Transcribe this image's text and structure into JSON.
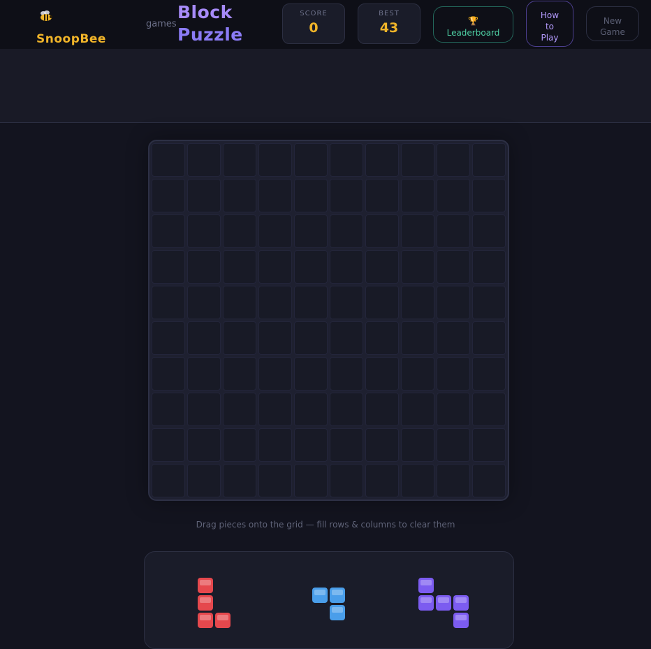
{
  "header": {
    "brand": "SnoopBee",
    "brand_sub": "games",
    "title_line1": "Block",
    "title_line2": "Puzzle"
  },
  "stats": {
    "score_label": "SCORE",
    "score_value": "0",
    "best_label": "BEST",
    "best_value": "43"
  },
  "buttons": {
    "leaderboard_label": "Leaderboard",
    "how_line1": "How",
    "how_line2": "to",
    "how_line3": "Play",
    "new_line1": "New",
    "new_line2": "Game"
  },
  "board": {
    "rows": 10,
    "cols": 10,
    "filled_cells": 0
  },
  "hint_text": "Drag pieces onto the grid — fill rows & columns to clear them",
  "pieces": [
    {
      "name": "red-l-piece",
      "color": "#e5484d",
      "shape": [
        [
          1,
          0
        ],
        [
          1,
          0
        ],
        [
          1,
          1
        ]
      ]
    },
    {
      "name": "blue-corner-piece",
      "color": "#4a9eea",
      "shape": [
        [
          1,
          1
        ],
        [
          0,
          1
        ]
      ]
    },
    {
      "name": "purple-t-piece",
      "color": "#7c5cf0",
      "shape": [
        [
          1,
          0,
          0
        ],
        [
          1,
          1,
          1
        ],
        [
          0,
          0,
          1
        ]
      ]
    }
  ],
  "colors": {
    "accent_gold": "#f0b429",
    "accent_purple": "#a78bfa",
    "accent_green": "#4fd1a5"
  }
}
